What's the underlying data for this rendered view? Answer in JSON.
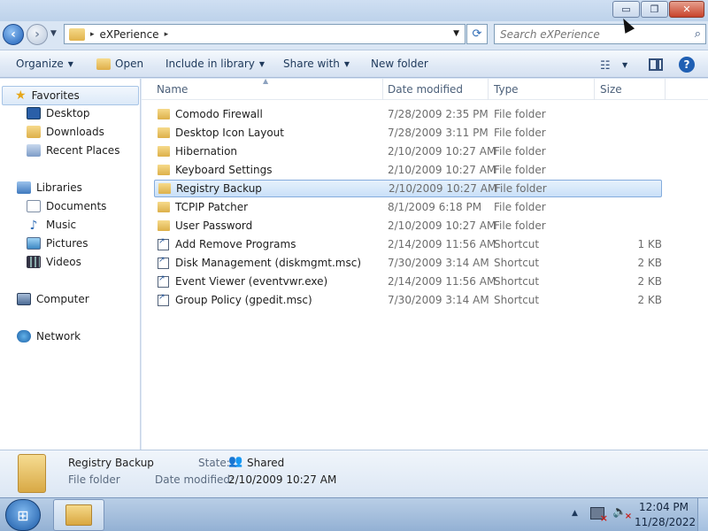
{
  "window": {
    "controls": {
      "minimize": "▭",
      "maximize": "❐",
      "close": "✕"
    }
  },
  "nav": {
    "back": "‹",
    "forward": "›"
  },
  "address": {
    "path": "eXPerience",
    "separator": "▸",
    "search_placeholder": "Search eXPerience"
  },
  "toolbar": {
    "organize": "Organize",
    "open": "Open",
    "include": "Include in library",
    "share": "Share with",
    "new_folder": "New folder"
  },
  "sidebar": {
    "favorites": "Favorites",
    "desktop": "Desktop",
    "downloads": "Downloads",
    "recent": "Recent Places",
    "libraries": "Libraries",
    "documents": "Documents",
    "music": "Music",
    "pictures": "Pictures",
    "videos": "Videos",
    "computer": "Computer",
    "network": "Network"
  },
  "columns": {
    "name": "Name",
    "date": "Date modified",
    "type": "Type",
    "size": "Size"
  },
  "files": [
    {
      "name": "Comodo Firewall",
      "date": "7/28/2009 2:35 PM",
      "type": "File folder",
      "size": "",
      "kind": "folder"
    },
    {
      "name": "Desktop Icon Layout",
      "date": "7/28/2009 3:11 PM",
      "type": "File folder",
      "size": "",
      "kind": "folder"
    },
    {
      "name": "Hibernation",
      "date": "2/10/2009 10:27 AM",
      "type": "File folder",
      "size": "",
      "kind": "folder"
    },
    {
      "name": "Keyboard Settings",
      "date": "2/10/2009 10:27 AM",
      "type": "File folder",
      "size": "",
      "kind": "folder"
    },
    {
      "name": "Registry Backup",
      "date": "2/10/2009 10:27 AM",
      "type": "File folder",
      "size": "",
      "kind": "folder",
      "selected": true
    },
    {
      "name": "TCPIP Patcher",
      "date": "8/1/2009 6:18 PM",
      "type": "File folder",
      "size": "",
      "kind": "folder"
    },
    {
      "name": "User Password",
      "date": "2/10/2009 10:27 AM",
      "type": "File folder",
      "size": "",
      "kind": "folder"
    },
    {
      "name": "Add Remove Programs",
      "date": "2/14/2009 11:56 AM",
      "type": "Shortcut",
      "size": "1 KB",
      "kind": "shortcut"
    },
    {
      "name": "Disk Management (diskmgmt.msc)",
      "date": "7/30/2009 3:14 AM",
      "type": "Shortcut",
      "size": "2 KB",
      "kind": "shortcut"
    },
    {
      "name": "Event Viewer (eventvwr.exe)",
      "date": "2/14/2009 11:56 AM",
      "type": "Shortcut",
      "size": "2 KB",
      "kind": "shortcut"
    },
    {
      "name": "Group Policy (gpedit.msc)",
      "date": "7/30/2009 3:14 AM",
      "type": "Shortcut",
      "size": "2 KB",
      "kind": "shortcut"
    }
  ],
  "details": {
    "name": "Registry Backup",
    "type": "File folder",
    "state_label": "State:",
    "state": "Shared",
    "date_label": "Date modified:",
    "date": "2/10/2009 10:27 AM"
  },
  "taskbar": {
    "time": "12:04 PM",
    "date": "11/28/2022"
  }
}
